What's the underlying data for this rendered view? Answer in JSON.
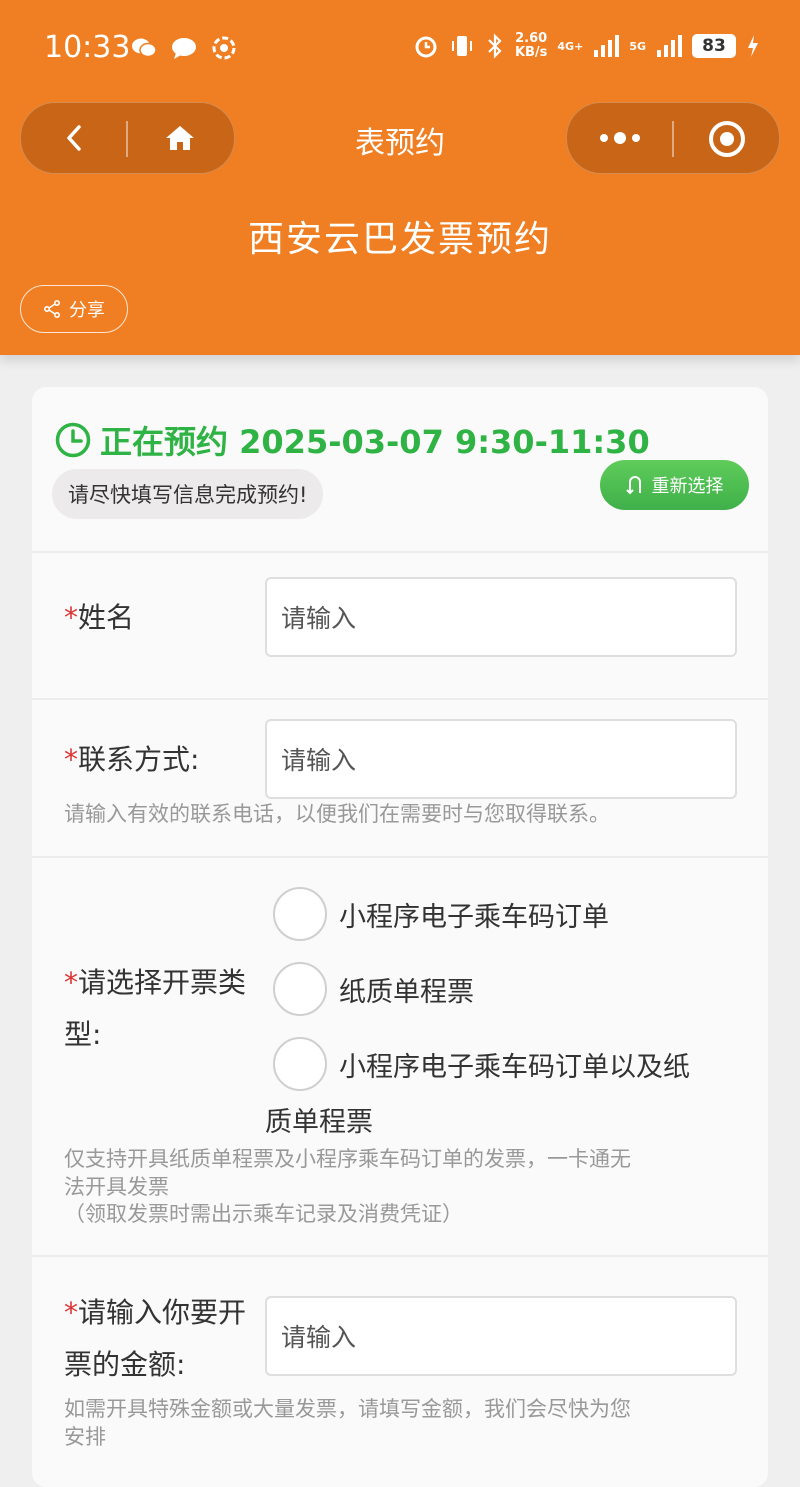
{
  "status_bar": {
    "time": "10:33",
    "net_speed_value": "2.60",
    "net_speed_unit": "KB/s",
    "signal_1": "4G+",
    "signal_2": "5G",
    "battery": "83"
  },
  "nav": {
    "title": "表预约"
  },
  "header": {
    "page_title": "西安云巴发票预约",
    "share_label": "分享"
  },
  "booking": {
    "status_text": "正在预约 2025-03-07 9:30-11:30",
    "reminder": "请尽快填写信息完成预约!",
    "reselect_label": "重新选择"
  },
  "form": {
    "required_mark": "*",
    "name": {
      "label": "姓名",
      "placeholder": "请输入"
    },
    "contact": {
      "label_line1": "联系方式:",
      "placeholder": "请输入",
      "hint": "请输入有效的联系电话，以便我们在需要时与您取得联系。"
    },
    "invoice_type": {
      "label_line1": "请选择开票类",
      "label_line2": "型:",
      "options": [
        "小程序电子乘车码订单",
        "纸质单程票",
        "小程序电子乘车码订单以及纸"
      ],
      "option3_wrap": "质单程票",
      "hint_line1": "仅支持开具纸质单程票及小程序乘车码订单的发票，一卡通无",
      "hint_line2": "法开具发票",
      "hint_line3": "（领取发票时需出示乘车记录及消费凭证）"
    },
    "amount": {
      "label_line1": "请输入你要开",
      "label_line2": "票的金额:",
      "placeholder": "请输入",
      "hint_line1": "如需开具特殊金额或大量发票，请填写金额，我们会尽快为您",
      "hint_line2": "安排"
    }
  },
  "colors": {
    "header_bg": "#ef7f22",
    "accent_green": "#2fb344",
    "required_red": "#d33333"
  },
  "icons": [
    "back-icon",
    "home-icon",
    "more-icon",
    "close-target-icon",
    "share-icon",
    "clock-icon",
    "refresh-icon"
  ]
}
